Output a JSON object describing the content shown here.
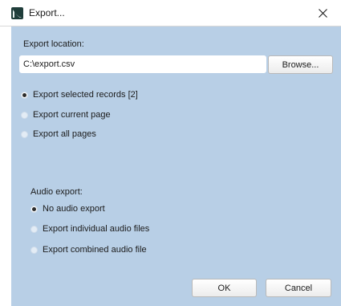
{
  "window": {
    "title": "Export...",
    "close_glyph": "close-icon"
  },
  "export_location": {
    "label": "Export location:",
    "value": "C:\\export.csv",
    "browse_label": "Browse..."
  },
  "record_scope": {
    "selected": "selected_records",
    "options": [
      {
        "id": "selected_records",
        "label": "Export selected records [2]",
        "checked": true
      },
      {
        "id": "current_page",
        "label": "Export current page",
        "checked": false
      },
      {
        "id": "all_pages",
        "label": "Export all pages",
        "checked": false
      }
    ]
  },
  "audio_export": {
    "label": "Audio export:",
    "selected": "no_audio",
    "options": [
      {
        "id": "no_audio",
        "label": "No audio export",
        "checked": true
      },
      {
        "id": "individual",
        "label": "Export individual audio files",
        "checked": false
      },
      {
        "id": "combined",
        "label": "Export combined audio file",
        "checked": false
      }
    ]
  },
  "footer": {
    "ok_label": "OK",
    "cancel_label": "Cancel"
  },
  "colors": {
    "panel_background": "#b8cfe6",
    "titlebar_background": "#ffffff"
  }
}
